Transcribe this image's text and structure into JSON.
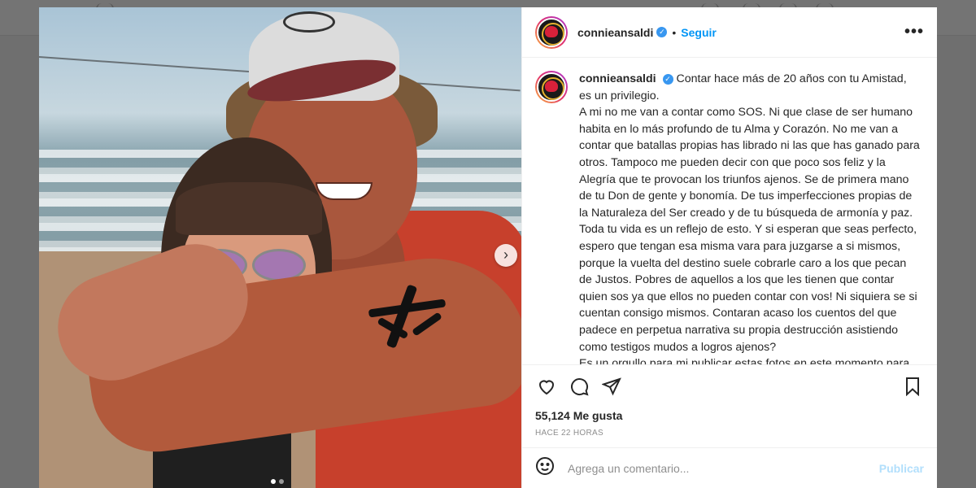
{
  "post": {
    "username": "connieansaldi",
    "follow_label": "Seguir",
    "separator": "•",
    "more_label": "•••",
    "caption_lines": [
      "Contar hace más de 20 años con tu Amistad, es un privilegio.",
      "A mi no me van a contar como SOS. Ni que clase de ser humano habita en lo más profundo de tu Alma y Corazón. No me van a contar que batallas propias has librado ni las que has ganado para otros. Tampoco me pueden decir con que poco sos feliz y la Alegría que te provocan los triunfos ajenos. Se de primera mano de tu Don de gente y bonomía. De tus imperfecciones propias de la Naturaleza del Ser creado y de tu búsqueda de armonía y paz. Toda tu vida es un reflejo de esto. Y si esperan que seas perfecto, espero que tengan esa misma vara para juzgarse a si mismos, porque la vuelta del destino suele cobrarle caro a los que pecan de Justos. Pobres de aquellos a los que les tienen que contar quien sos ya que ellos no pueden contar con vos! Ni siquiera se si cuentan consigo mismos. Contaran acaso los cuentos del que padece en perpetua narrativa su propia destrucción asistiendo como testigos mudos a logros ajenos?",
      "Es un orgullo para mi publicar estas fotos en este momento para recordarte y recordarles a todos, que sos mi amigo. Y que te quiero."
    ],
    "likes": "55,124 Me gusta",
    "time": "HACE 22 HORAS",
    "comment_placeholder": "Agrega un comentario...",
    "publish_label": "Publicar",
    "next_label": "›",
    "carousel_count": 2,
    "carousel_active": 1
  },
  "icons": {
    "like": "heart-icon",
    "comment": "comment-icon",
    "share": "share-icon",
    "save": "bookmark-icon",
    "emoji": "emoji-icon",
    "verified": "verified-badge-icon"
  },
  "colors": {
    "accent": "#0095f6",
    "verified": "#3897f0",
    "publish_disabled": "#b2dffc",
    "muted": "#8e8e8e"
  }
}
